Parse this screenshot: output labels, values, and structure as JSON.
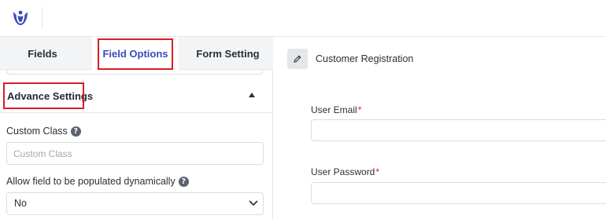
{
  "tabs": {
    "fields": "Fields",
    "field_options": "Field Options",
    "form_setting": "Form Setting"
  },
  "advance_settings": {
    "title": "Advance Settings",
    "custom_class": {
      "label": "Custom Class",
      "placeholder": "Custom Class"
    },
    "allow_dynamic": {
      "label": "Allow field to be populated dynamically",
      "selected": "No"
    }
  },
  "form": {
    "title": "Customer Registration",
    "fields": [
      {
        "label": "User Email",
        "required_mark": "*"
      },
      {
        "label": "User Password",
        "required_mark": "*"
      }
    ]
  },
  "icons": {
    "help": "?",
    "logo": "brand-logo-icon",
    "edit": "pencil-icon",
    "collapse": "caret-up-icon",
    "dropdown": "chevron-down-icon"
  },
  "colors": {
    "accent": "#3a4bb8",
    "highlight": "#d81e25",
    "required": "#d81e25"
  }
}
